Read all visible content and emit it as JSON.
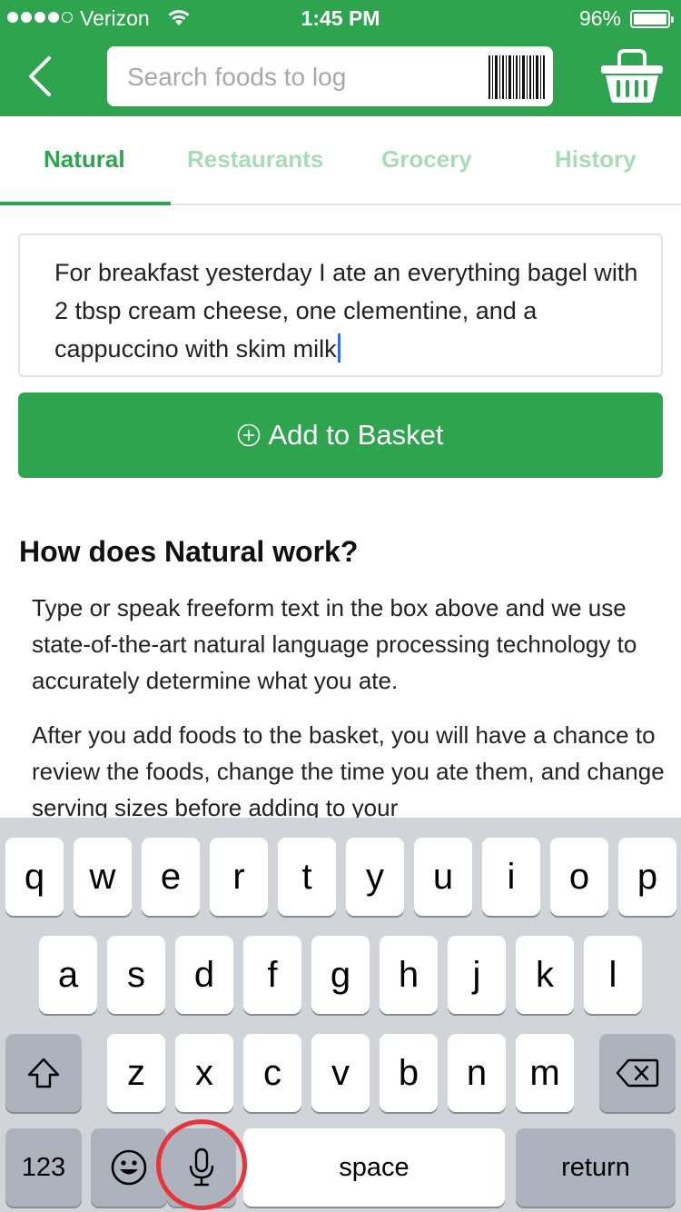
{
  "status_bar": {
    "carrier": "Verizon",
    "time": "1:45 PM",
    "battery": "96%",
    "signal_bars_filled": 4,
    "signal_bars_total": 5
  },
  "header": {
    "back_icon": "chevron-left-icon",
    "search_placeholder": "Search foods to log",
    "barcode_icon": "barcode-icon",
    "basket_icon": "basket-icon"
  },
  "tabs": [
    {
      "label": "Natural",
      "active": true
    },
    {
      "label": "Restaurants",
      "active": false
    },
    {
      "label": "Grocery",
      "active": false
    },
    {
      "label": "History",
      "active": false
    }
  ],
  "entry": {
    "text": "For breakfast yesterday I ate an everything bagel with 2 tbsp cream cheese, one clementine, and a cappuccino with skim milk"
  },
  "add_button": {
    "label": "Add to Basket",
    "icon": "plus-circle-icon"
  },
  "info": {
    "title": "How does Natural work?",
    "paragraphs": [
      "Type or speak freeform text in the box above and we use state-of-the-art natural language processing technology to accurately determine what you ate.",
      "After you add foods to the basket, you will have a chance to review the foods, change the time you ate them, and change serving sizes before adding to your"
    ]
  },
  "keyboard": {
    "row1": [
      "q",
      "w",
      "e",
      "r",
      "t",
      "y",
      "u",
      "i",
      "o",
      "p"
    ],
    "row2": [
      "a",
      "s",
      "d",
      "f",
      "g",
      "h",
      "j",
      "k",
      "l"
    ],
    "row3": [
      "z",
      "x",
      "c",
      "v",
      "b",
      "n",
      "m"
    ],
    "shift_icon": "shift-icon",
    "delete_icon": "delete-icon",
    "numbers_label": "123",
    "emoji_icon": "emoji-icon",
    "mic_icon": "microphone-icon",
    "space_label": "space",
    "return_label": "return"
  },
  "colors": {
    "brand_green": "#2ea44f",
    "tab_inactive": "#a9dbb9",
    "highlight_circle": "#e8323c"
  }
}
